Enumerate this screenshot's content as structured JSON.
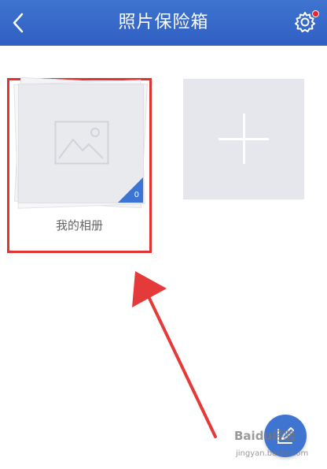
{
  "header": {
    "title": "照片保险箱",
    "back_icon": "chevron-left-icon",
    "settings_icon": "gear-icon",
    "background": "#3366cc",
    "notification_color": "#e8262a"
  },
  "albums": [
    {
      "name": "我的相册",
      "count": "0"
    }
  ],
  "add_album": {
    "icon": "plus-icon"
  },
  "fab": {
    "icon": "edit-icon",
    "color": "#3f74d0"
  },
  "highlight_color": "#e03434",
  "watermark": {
    "main": "Baidu经验",
    "sub": "jingyan.baidu.com"
  }
}
